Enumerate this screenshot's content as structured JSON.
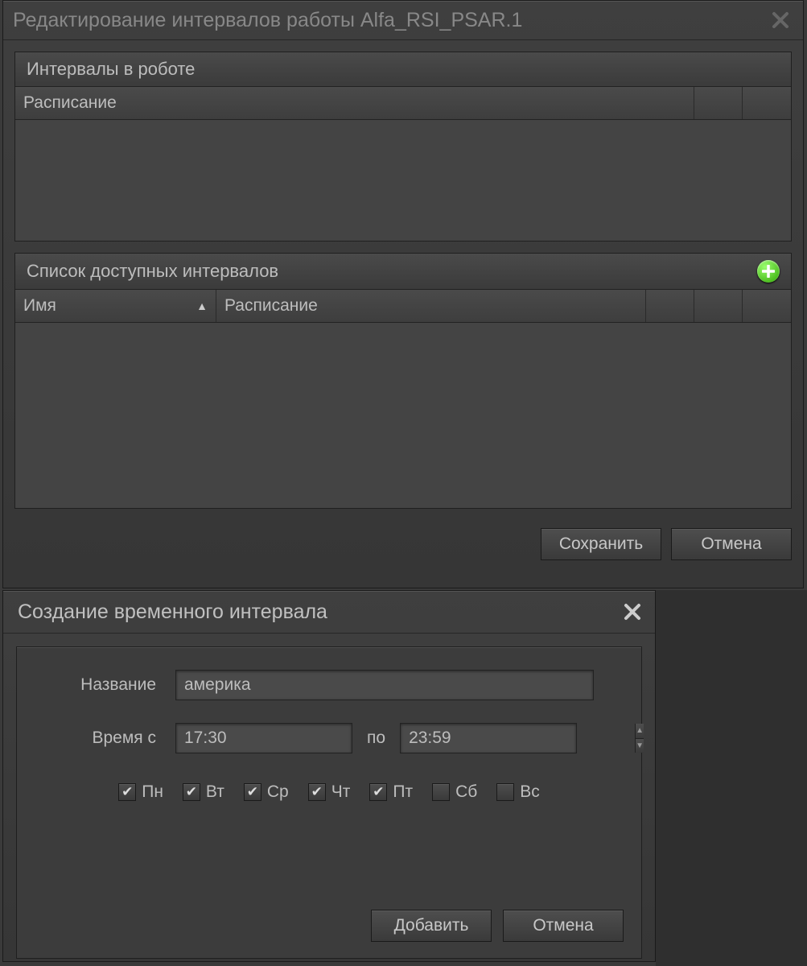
{
  "window1": {
    "title": "Редактирование интервалов работы Alfa_RSI_PSAR.1",
    "section1": {
      "title": "Интервалы в роботе",
      "col_schedule": "Расписание"
    },
    "section2": {
      "title": "Список доступных интервалов",
      "col_name": "Имя",
      "col_schedule": "Расписание"
    },
    "buttons": {
      "save": "Сохранить",
      "cancel": "Отмена"
    }
  },
  "window2": {
    "title": "Создание временного интервала",
    "fields": {
      "name_label": "Название",
      "name_value": "америка",
      "time_from_label": "Время с",
      "time_from_value": "17:30",
      "time_to_label": "по",
      "time_to_value": "23:59"
    },
    "days": [
      {
        "label": "Пн",
        "checked": true
      },
      {
        "label": "Вт",
        "checked": true
      },
      {
        "label": "Ср",
        "checked": true
      },
      {
        "label": "Чт",
        "checked": true
      },
      {
        "label": "Пт",
        "checked": true
      },
      {
        "label": "Сб",
        "checked": false
      },
      {
        "label": "Вс",
        "checked": false
      }
    ],
    "buttons": {
      "add": "Добавить",
      "cancel": "Отмена"
    }
  }
}
